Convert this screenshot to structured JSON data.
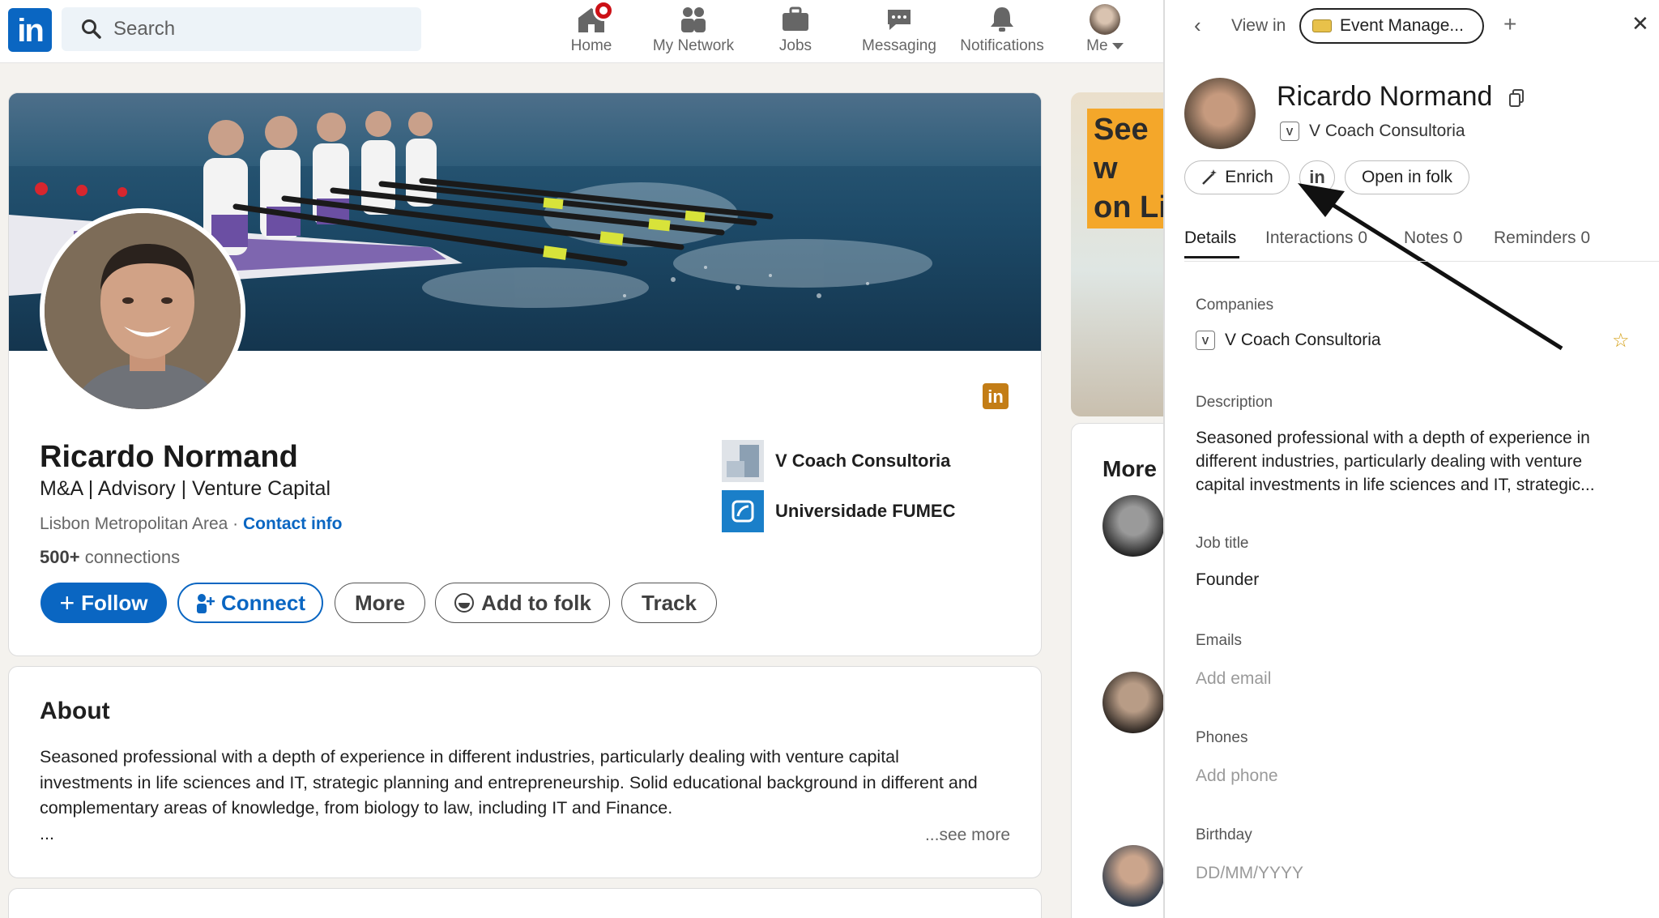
{
  "header": {
    "search_placeholder": "Search",
    "nav": {
      "home": "Home",
      "network": "My Network",
      "jobs": "Jobs",
      "messaging": "Messaging",
      "notifications": "Notifications",
      "me": "Me"
    }
  },
  "profile": {
    "name": "Ricardo Normand",
    "headline": "M&A | Advisory | Venture Capital",
    "location": "Lisbon Metropolitan Area",
    "separator": "·",
    "contact_info": "Contact info",
    "connections_count": "500+",
    "connections_label": "connections",
    "buttons": {
      "follow": "Follow",
      "connect": "Connect",
      "more": "More",
      "add_to_folk": "Add to folk",
      "track": "Track"
    },
    "experience": [
      {
        "name": "V Coach Consultoria"
      },
      {
        "name": "Universidade FUMEC"
      }
    ]
  },
  "about": {
    "title": "About",
    "text": "Seasoned professional with a depth of experience in different industries, particularly dealing with venture capital investments in life sciences and IT, strategic planning and entrepreneurship. Solid educational background in different and complementary areas of knowledge, from biology to law, including IT and Finance.",
    "ellipsis": "...",
    "see_more": "...see more"
  },
  "sidebar": {
    "ad_text_1": "See w",
    "ad_text_2": "on Li",
    "more_title": "More p"
  },
  "panel": {
    "view_in_label": "View in",
    "workspace": "Event Manage...",
    "contact_name": "Ricardo Normand",
    "company": "V Coach Consultoria",
    "company_initial": "V",
    "actions": {
      "enrich": "Enrich",
      "open_in_folk": "Open in folk"
    },
    "tabs": {
      "details": "Details",
      "interactions": "Interactions",
      "interactions_count": "0",
      "notes": "Notes",
      "notes_count": "0",
      "reminders": "Reminders",
      "reminders_count": "0"
    },
    "fields": {
      "companies_label": "Companies",
      "companies_value": "V Coach Consultoria",
      "description_label": "Description",
      "description_value": "Seasoned professional with a depth of experience in different industries, particularly dealing with venture capital investments in life sciences and IT, strategic...",
      "job_title_label": "Job title",
      "job_title_value": "Founder",
      "emails_label": "Emails",
      "emails_placeholder": "Add email",
      "phones_label": "Phones",
      "phones_placeholder": "Add phone",
      "birthday_label": "Birthday",
      "birthday_placeholder": "DD/MM/YYYY"
    }
  },
  "colors": {
    "linkedin_blue": "#0a66c2",
    "notification_red": "#cc1016",
    "star_gold": "#d4a017"
  }
}
